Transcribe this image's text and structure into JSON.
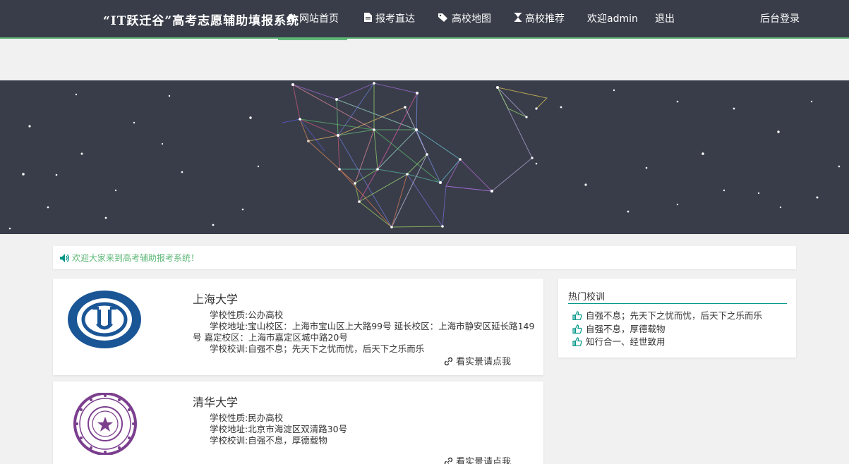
{
  "header": {
    "site_title": "“IT跃迁谷”高考志愿辅助填报系统",
    "nav": [
      {
        "label": "网站首页",
        "icon": "home-icon",
        "active": true
      },
      {
        "label": "报考直达",
        "icon": "document-icon",
        "active": false
      },
      {
        "label": "高校地图",
        "icon": "tags-icon",
        "active": false
      },
      {
        "label": "高校推荐",
        "icon": "hourglass-icon",
        "active": false
      },
      {
        "label": "欢迎admin",
        "icon": "",
        "active": false
      },
      {
        "label": "退出",
        "icon": "",
        "active": false
      },
      {
        "label": "后台登录",
        "icon": "",
        "active": false
      }
    ]
  },
  "notice": {
    "icon": "speaker-icon",
    "text": "欢迎大家来到高考辅助报考系统！"
  },
  "schools": [
    {
      "name": "上海大学",
      "type": "学校性质:公办高校",
      "address": "学校地址:宝山校区：上海市宝山区上大路99号 延长校区：上海市静安区延长路149号 嘉定校区：上海市嘉定区城中路20号",
      "motto": "学校校训:自强不息；先天下之忧而忧，后天下之乐而乐",
      "link": "看实景请点我",
      "logo_icon": "shanghai-university-logo"
    },
    {
      "name": "清华大学",
      "type": "学校性质:民办高校",
      "address": "学校地址:北京市海淀区双清路30号",
      "motto": "学校校训:自强不息，厚德载物",
      "link": "看实景请点我",
      "logo_icon": "tsinghua-university-logo"
    }
  ],
  "hot_mottos": {
    "title": "热门校训",
    "items": [
      "自强不息；先天下之忧而忧，后天下之乐而乐",
      "自强不息，厚德载物",
      "知行合一、经世致用"
    ]
  },
  "colors": {
    "header_bg": "#393d49",
    "accent_green": "#5fb878",
    "teal": "#009688",
    "page_bg": "#f1f1f1"
  }
}
